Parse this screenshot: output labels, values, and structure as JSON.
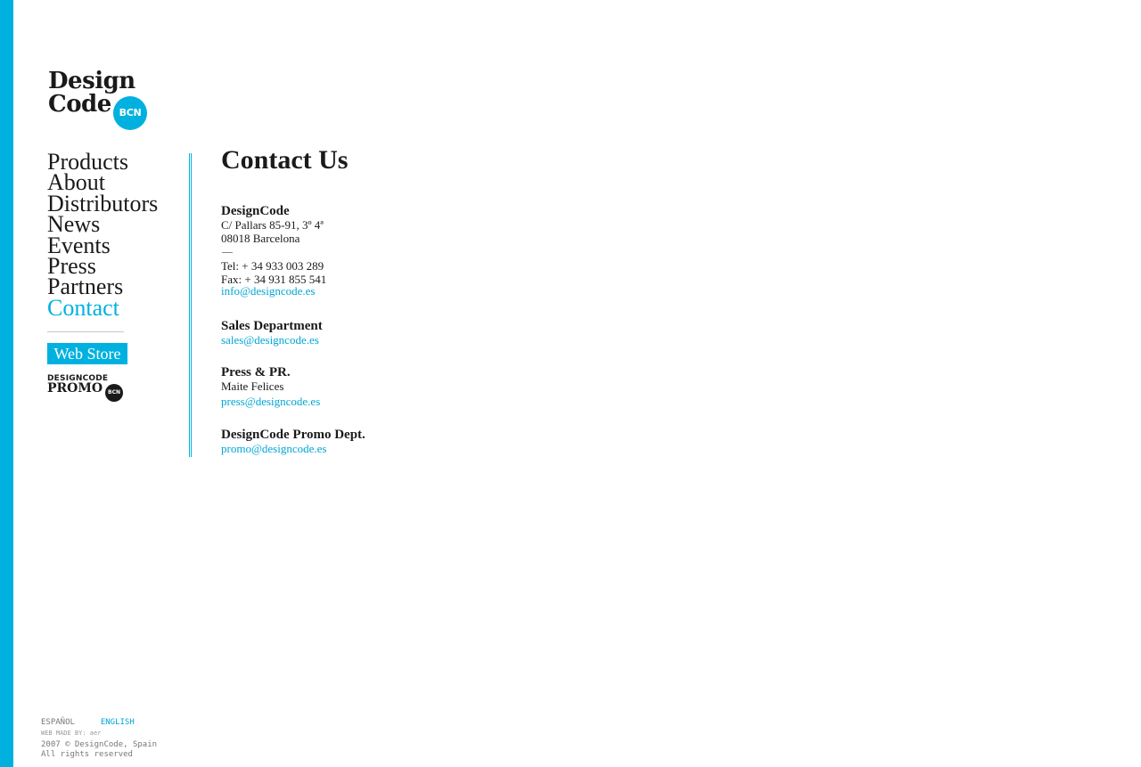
{
  "brand": {
    "logo_line1": "Design",
    "logo_line2": "Code",
    "logo_badge": "BCN",
    "accent_color": "#00b1e0"
  },
  "nav": {
    "items": [
      {
        "label": "Products"
      },
      {
        "label": "About"
      },
      {
        "label": "Distributors"
      },
      {
        "label": "News"
      },
      {
        "label": "Events"
      },
      {
        "label": "Press"
      },
      {
        "label": "Partners"
      },
      {
        "label": "Contact",
        "active": true
      }
    ],
    "webstore_label": "Web Store",
    "promo_top": "DESIGNCODE",
    "promo_bottom": "PROMO",
    "promo_badge": "BCN"
  },
  "main": {
    "title": "Contact Us",
    "company": {
      "name": "DesignCode",
      "address1": "C/ Pallars 85-91, 3º 4ª",
      "address2": "08018 Barcelona",
      "tel": "Tel:  + 34 933 003 289",
      "fax": "Fax: + 34 931 855 541",
      "email": "info@designcode.es"
    },
    "sales": {
      "heading": "Sales Department",
      "email": "sales@designcode.es"
    },
    "press": {
      "heading": "Press & PR.",
      "contact": "Maite Felices",
      "email": "press@designcode.es"
    },
    "promo": {
      "heading": "DesignCode Promo Dept.",
      "email": "promo@designcode.es"
    }
  },
  "footer": {
    "lang_es": "ESPAÑOL",
    "lang_en": "ENGLISH",
    "made_by": "WEB MADE BY: aer",
    "copyright": "2007 © DesignCode, Spain",
    "rights": "All rights reserved"
  }
}
